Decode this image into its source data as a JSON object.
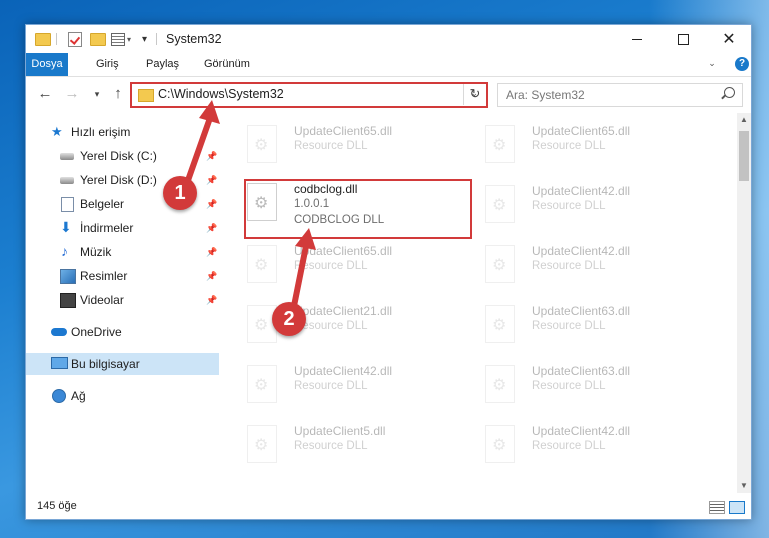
{
  "window": {
    "title": "System32"
  },
  "ribbon": {
    "tabs": [
      "Dosya",
      "Giriş",
      "Paylaş",
      "Görünüm"
    ],
    "help_label": "?"
  },
  "address_bar": {
    "path": "C:\\Windows\\System32"
  },
  "search": {
    "placeholder": "Ara: System32"
  },
  "nav_pane": {
    "quick_access": "Hızlı erişim",
    "items": [
      {
        "label": "Yerel Disk (C:)",
        "icon": "drive-icon",
        "pinned": true
      },
      {
        "label": "Yerel Disk (D:)",
        "icon": "drive-icon",
        "pinned": true
      },
      {
        "label": "Belgeler",
        "icon": "documents-icon",
        "pinned": true
      },
      {
        "label": "İndirmeler",
        "icon": "downloads-icon",
        "pinned": true
      },
      {
        "label": "Müzik",
        "icon": "music-icon",
        "pinned": true
      },
      {
        "label": "Resimler",
        "icon": "pictures-icon",
        "pinned": true
      },
      {
        "label": "Videolar",
        "icon": "videos-icon",
        "pinned": true
      }
    ],
    "onedrive": "OneDrive",
    "this_pc": "Bu bilgisayar",
    "network": "Ağ"
  },
  "files": {
    "highlighted": {
      "name": "codbclog.dll",
      "version": "1.0.0.1",
      "description": "CODBCLOG DLL"
    },
    "left_column": [
      {
        "name": "UpdateClient65.dll",
        "description": "Resource DLL"
      },
      {
        "name": "UpdateClient65.dll",
        "description": "Resource DLL"
      },
      {
        "name": "UpdateClient21.dll",
        "description": "Resource DLL"
      },
      {
        "name": "UpdateClient42.dll",
        "description": "Resource DLL"
      },
      {
        "name": "UpdateClient5.dll",
        "description": "Resource DLL"
      }
    ],
    "right_column": [
      {
        "name": "UpdateClient65.dll",
        "description": "Resource DLL"
      },
      {
        "name": "UpdateClient42.dll",
        "description": "Resource DLL"
      },
      {
        "name": "UpdateClient42.dll",
        "description": "Resource DLL"
      },
      {
        "name": "UpdateClient63.dll",
        "description": "Resource DLL"
      },
      {
        "name": "UpdateClient63.dll",
        "description": "Resource DLL"
      },
      {
        "name": "UpdateClient42.dll",
        "description": "Resource DLL"
      }
    ]
  },
  "status_bar": {
    "item_count": "145 öğe"
  },
  "callouts": {
    "step1": "1",
    "step2": "2",
    "color": "#d23a3a"
  }
}
